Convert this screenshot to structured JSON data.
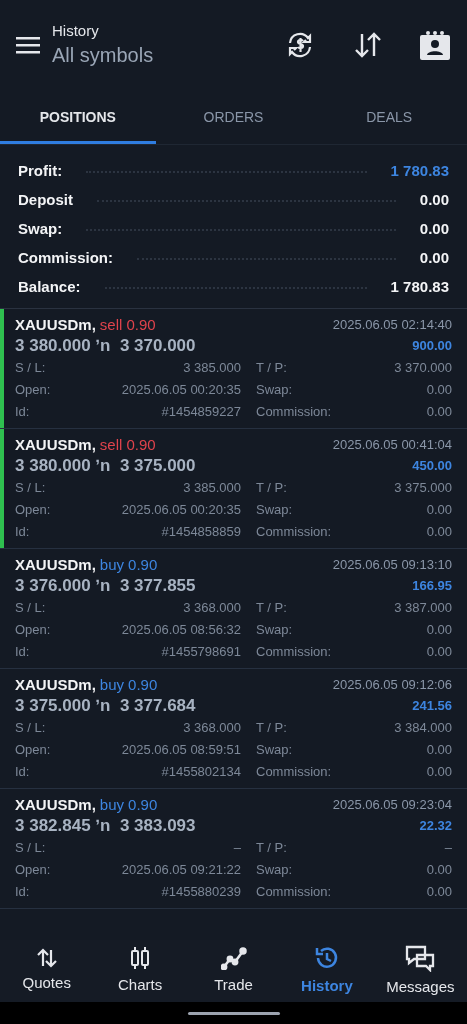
{
  "header": {
    "title": "History",
    "subtitle": "All symbols"
  },
  "tabs": [
    {
      "label": "POSITIONS",
      "selected": true
    },
    {
      "label": "ORDERS",
      "selected": false
    },
    {
      "label": "DEALS",
      "selected": false
    }
  ],
  "summary": [
    {
      "label": "Profit:",
      "value": "1 780.83",
      "highlight": true
    },
    {
      "label": "Deposit",
      "value": "0.00",
      "highlight": false
    },
    {
      "label": "Swap:",
      "value": "0.00",
      "highlight": false
    },
    {
      "label": "Commission:",
      "value": "0.00",
      "highlight": false
    },
    {
      "label": "Balance:",
      "value": "1 780.83",
      "highlight": false
    }
  ],
  "positions": [
    {
      "symbol": "XAUUSDm,",
      "side": "sell",
      "volume": "0.90",
      "prices": "3 380.000 ʼn  3 370.000",
      "time": "2025.06.05 02:14:40",
      "profit": "900.00",
      "marked": true,
      "fields": [
        {
          "label": "S / L:",
          "value": "3 385.000"
        },
        {
          "label": "T / P:",
          "value": "3 370.000"
        },
        {
          "label": "Open:",
          "value": "2025.06.05 00:20:35"
        },
        {
          "label": "Swap:",
          "value": "0.00"
        },
        {
          "label": "Id:",
          "value": "#1454859227"
        },
        {
          "label": "Commission:",
          "value": "0.00"
        }
      ]
    },
    {
      "symbol": "XAUUSDm,",
      "side": "sell",
      "volume": "0.90",
      "prices": "3 380.000 ʼn  3 375.000",
      "time": "2025.06.05 00:41:04",
      "profit": "450.00",
      "marked": true,
      "fields": [
        {
          "label": "S / L:",
          "value": "3 385.000"
        },
        {
          "label": "T / P:",
          "value": "3 375.000"
        },
        {
          "label": "Open:",
          "value": "2025.06.05 00:20:35"
        },
        {
          "label": "Swap:",
          "value": "0.00"
        },
        {
          "label": "Id:",
          "value": "#1454858859"
        },
        {
          "label": "Commission:",
          "value": "0.00"
        }
      ]
    },
    {
      "symbol": "XAUUSDm,",
      "side": "buy",
      "volume": "0.90",
      "prices": "3 376.000 ʼn  3 377.855",
      "time": "2025.06.05 09:13:10",
      "profit": "166.95",
      "marked": false,
      "fields": [
        {
          "label": "S / L:",
          "value": "3 368.000"
        },
        {
          "label": "T / P:",
          "value": "3 387.000"
        },
        {
          "label": "Open:",
          "value": "2025.06.05 08:56:32"
        },
        {
          "label": "Swap:",
          "value": "0.00"
        },
        {
          "label": "Id:",
          "value": "#1455798691"
        },
        {
          "label": "Commission:",
          "value": "0.00"
        }
      ]
    },
    {
      "symbol": "XAUUSDm,",
      "side": "buy",
      "volume": "0.90",
      "prices": "3 375.000 ʼn  3 377.684",
      "time": "2025.06.05 09:12:06",
      "profit": "241.56",
      "marked": false,
      "fields": [
        {
          "label": "S / L:",
          "value": "3 368.000"
        },
        {
          "label": "T / P:",
          "value": "3 384.000"
        },
        {
          "label": "Open:",
          "value": "2025.06.05 08:59:51"
        },
        {
          "label": "Swap:",
          "value": "0.00"
        },
        {
          "label": "Id:",
          "value": "#1455802134"
        },
        {
          "label": "Commission:",
          "value": "0.00"
        }
      ]
    },
    {
      "symbol": "XAUUSDm,",
      "side": "buy",
      "volume": "0.90",
      "prices": "3 382.845 ʼn  3 383.093",
      "time": "2025.06.05 09:23:04",
      "profit": "22.32",
      "marked": false,
      "fields": [
        {
          "label": "S / L:",
          "value": "–"
        },
        {
          "label": "T / P:",
          "value": "–"
        },
        {
          "label": "Open:",
          "value": "2025.06.05 09:21:22"
        },
        {
          "label": "Swap:",
          "value": "0.00"
        },
        {
          "label": "Id:",
          "value": "#1455880239"
        },
        {
          "label": "Commission:",
          "value": "0.00"
        }
      ]
    }
  ],
  "nav": [
    {
      "label": "Quotes",
      "kind": "quotes",
      "selected": false
    },
    {
      "label": "Charts",
      "kind": "charts",
      "selected": false
    },
    {
      "label": "Trade",
      "kind": "trade",
      "selected": false
    },
    {
      "label": "History",
      "kind": "history",
      "selected": true
    },
    {
      "label": "Messages",
      "kind": "messages",
      "selected": false
    }
  ]
}
